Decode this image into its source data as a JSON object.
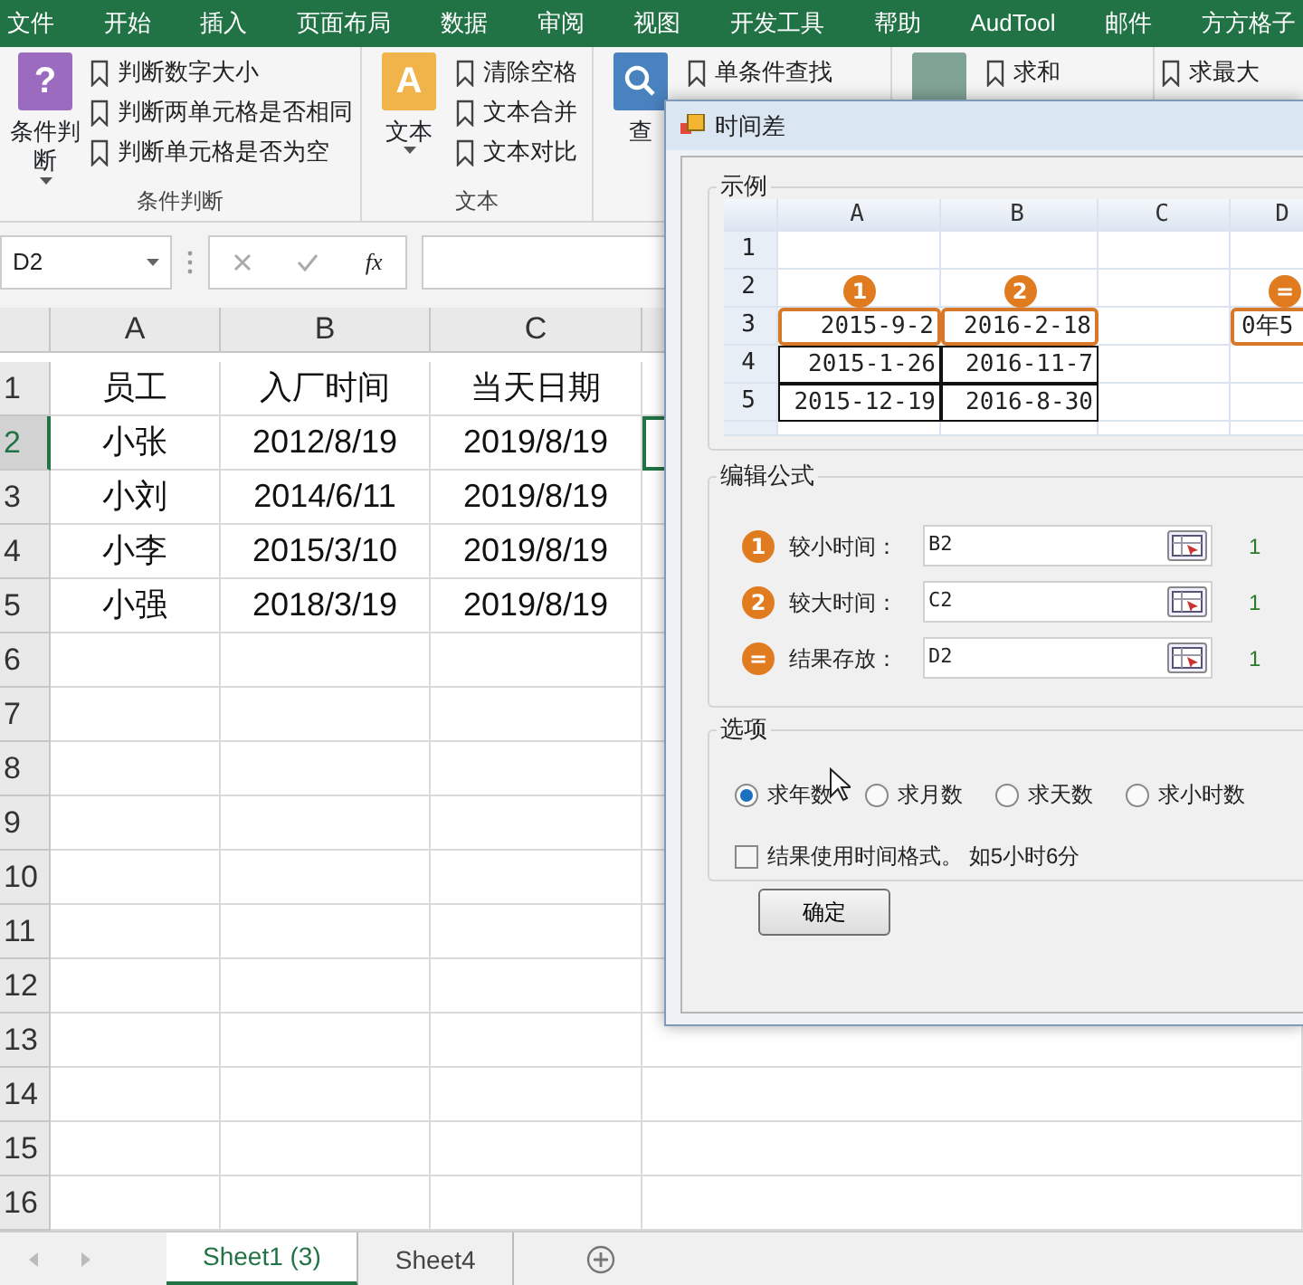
{
  "menu_tabs": [
    "文件",
    "开始",
    "插入",
    "页面布局",
    "数据",
    "审阅",
    "视图",
    "开发工具",
    "帮助",
    "AudTool",
    "邮件",
    "方方格子"
  ],
  "ribbon": {
    "groups": [
      {
        "kind": "question",
        "glyph": "?",
        "big_label": "条件判断",
        "items": [
          "判断数字大小",
          "判断两单元格是否相同",
          "判断单元格是否为空"
        ],
        "label": "条件判断"
      },
      {
        "kind": "letter",
        "glyph": "A",
        "big_label": "文本",
        "items": [
          "清除空格",
          "文本合并",
          "文本对比"
        ],
        "label": "文本"
      },
      {
        "kind": "search",
        "big_label": "查",
        "items": [
          "单条件查找"
        ]
      },
      {
        "kind": "plain",
        "items": [
          "求和"
        ]
      },
      {
        "kind": "none",
        "items": [
          "求最大"
        ]
      }
    ]
  },
  "formula_bar": {
    "name_box": "D2",
    "function_label": "fx"
  },
  "sheet": {
    "columns": [
      "A",
      "B",
      "C"
    ],
    "rows": [
      {
        "num": "1",
        "active": false,
        "cells": [
          "员工",
          "入厂时间",
          "当天日期"
        ]
      },
      {
        "num": "2",
        "active": true,
        "cells": [
          "小张",
          "2012/8/19",
          "2019/8/19"
        ]
      },
      {
        "num": "3",
        "active": false,
        "cells": [
          "小刘",
          "2014/6/11",
          "2019/8/19"
        ]
      },
      {
        "num": "4",
        "active": false,
        "cells": [
          "小李",
          "2015/3/10",
          "2019/8/19"
        ]
      },
      {
        "num": "5",
        "active": false,
        "cells": [
          "小强",
          "2018/3/19",
          "2019/8/19"
        ]
      },
      {
        "num": "6",
        "active": false
      },
      {
        "num": "7",
        "active": false
      },
      {
        "num": "8",
        "active": false
      },
      {
        "num": "9",
        "active": false
      },
      {
        "num": "10",
        "active": false
      },
      {
        "num": "11",
        "active": false
      },
      {
        "num": "12",
        "active": false
      },
      {
        "num": "13",
        "active": false
      },
      {
        "num": "14",
        "active": false
      },
      {
        "num": "15",
        "active": false
      },
      {
        "num": "16",
        "active": false
      }
    ]
  },
  "sheet_tabs": [
    {
      "label": "Sheet1 (3)",
      "selected": true
    },
    {
      "label": "Sheet4",
      "selected": false
    }
  ],
  "dialog": {
    "title": "时间差",
    "example": {
      "label": "示例",
      "columns": [
        "A",
        "B",
        "C",
        "D"
      ],
      "rows": [
        {
          "num": "1"
        },
        {
          "num": "2"
        },
        {
          "num": "3",
          "cells": [
            {
              "text": "2015-9-2",
              "marker": "1"
            },
            {
              "text": "2016-2-18",
              "marker": "2"
            },
            null,
            {
              "text": "0年5",
              "marker": "="
            }
          ]
        },
        {
          "num": "4",
          "cells": [
            {
              "text": "2015-1-26"
            },
            {
              "text": "2016-11-7"
            }
          ]
        },
        {
          "num": "5",
          "cells": [
            {
              "text": "2015-12-19"
            },
            {
              "text": "2016-8-30"
            }
          ]
        }
      ]
    },
    "formula": {
      "label": "编辑公式",
      "rows": [
        {
          "badge": "1",
          "label": "较小时间：",
          "value": "B2",
          "note": "1"
        },
        {
          "badge": "2",
          "label": "较大时间：",
          "value": "C2",
          "note": "1"
        },
        {
          "badge": "=",
          "label": "结果存放：",
          "value": "D2",
          "note": "1"
        }
      ]
    },
    "options": {
      "label": "选项",
      "radios": [
        {
          "label": "求年数",
          "selected": true
        },
        {
          "label": "求月数",
          "selected": false
        },
        {
          "label": "求天数",
          "selected": false
        },
        {
          "label": "求小时数",
          "selected": false
        }
      ],
      "checkbox": {
        "label": "结果使用时间格式。 如5小时6分",
        "checked": false
      }
    },
    "button": "确定"
  }
}
